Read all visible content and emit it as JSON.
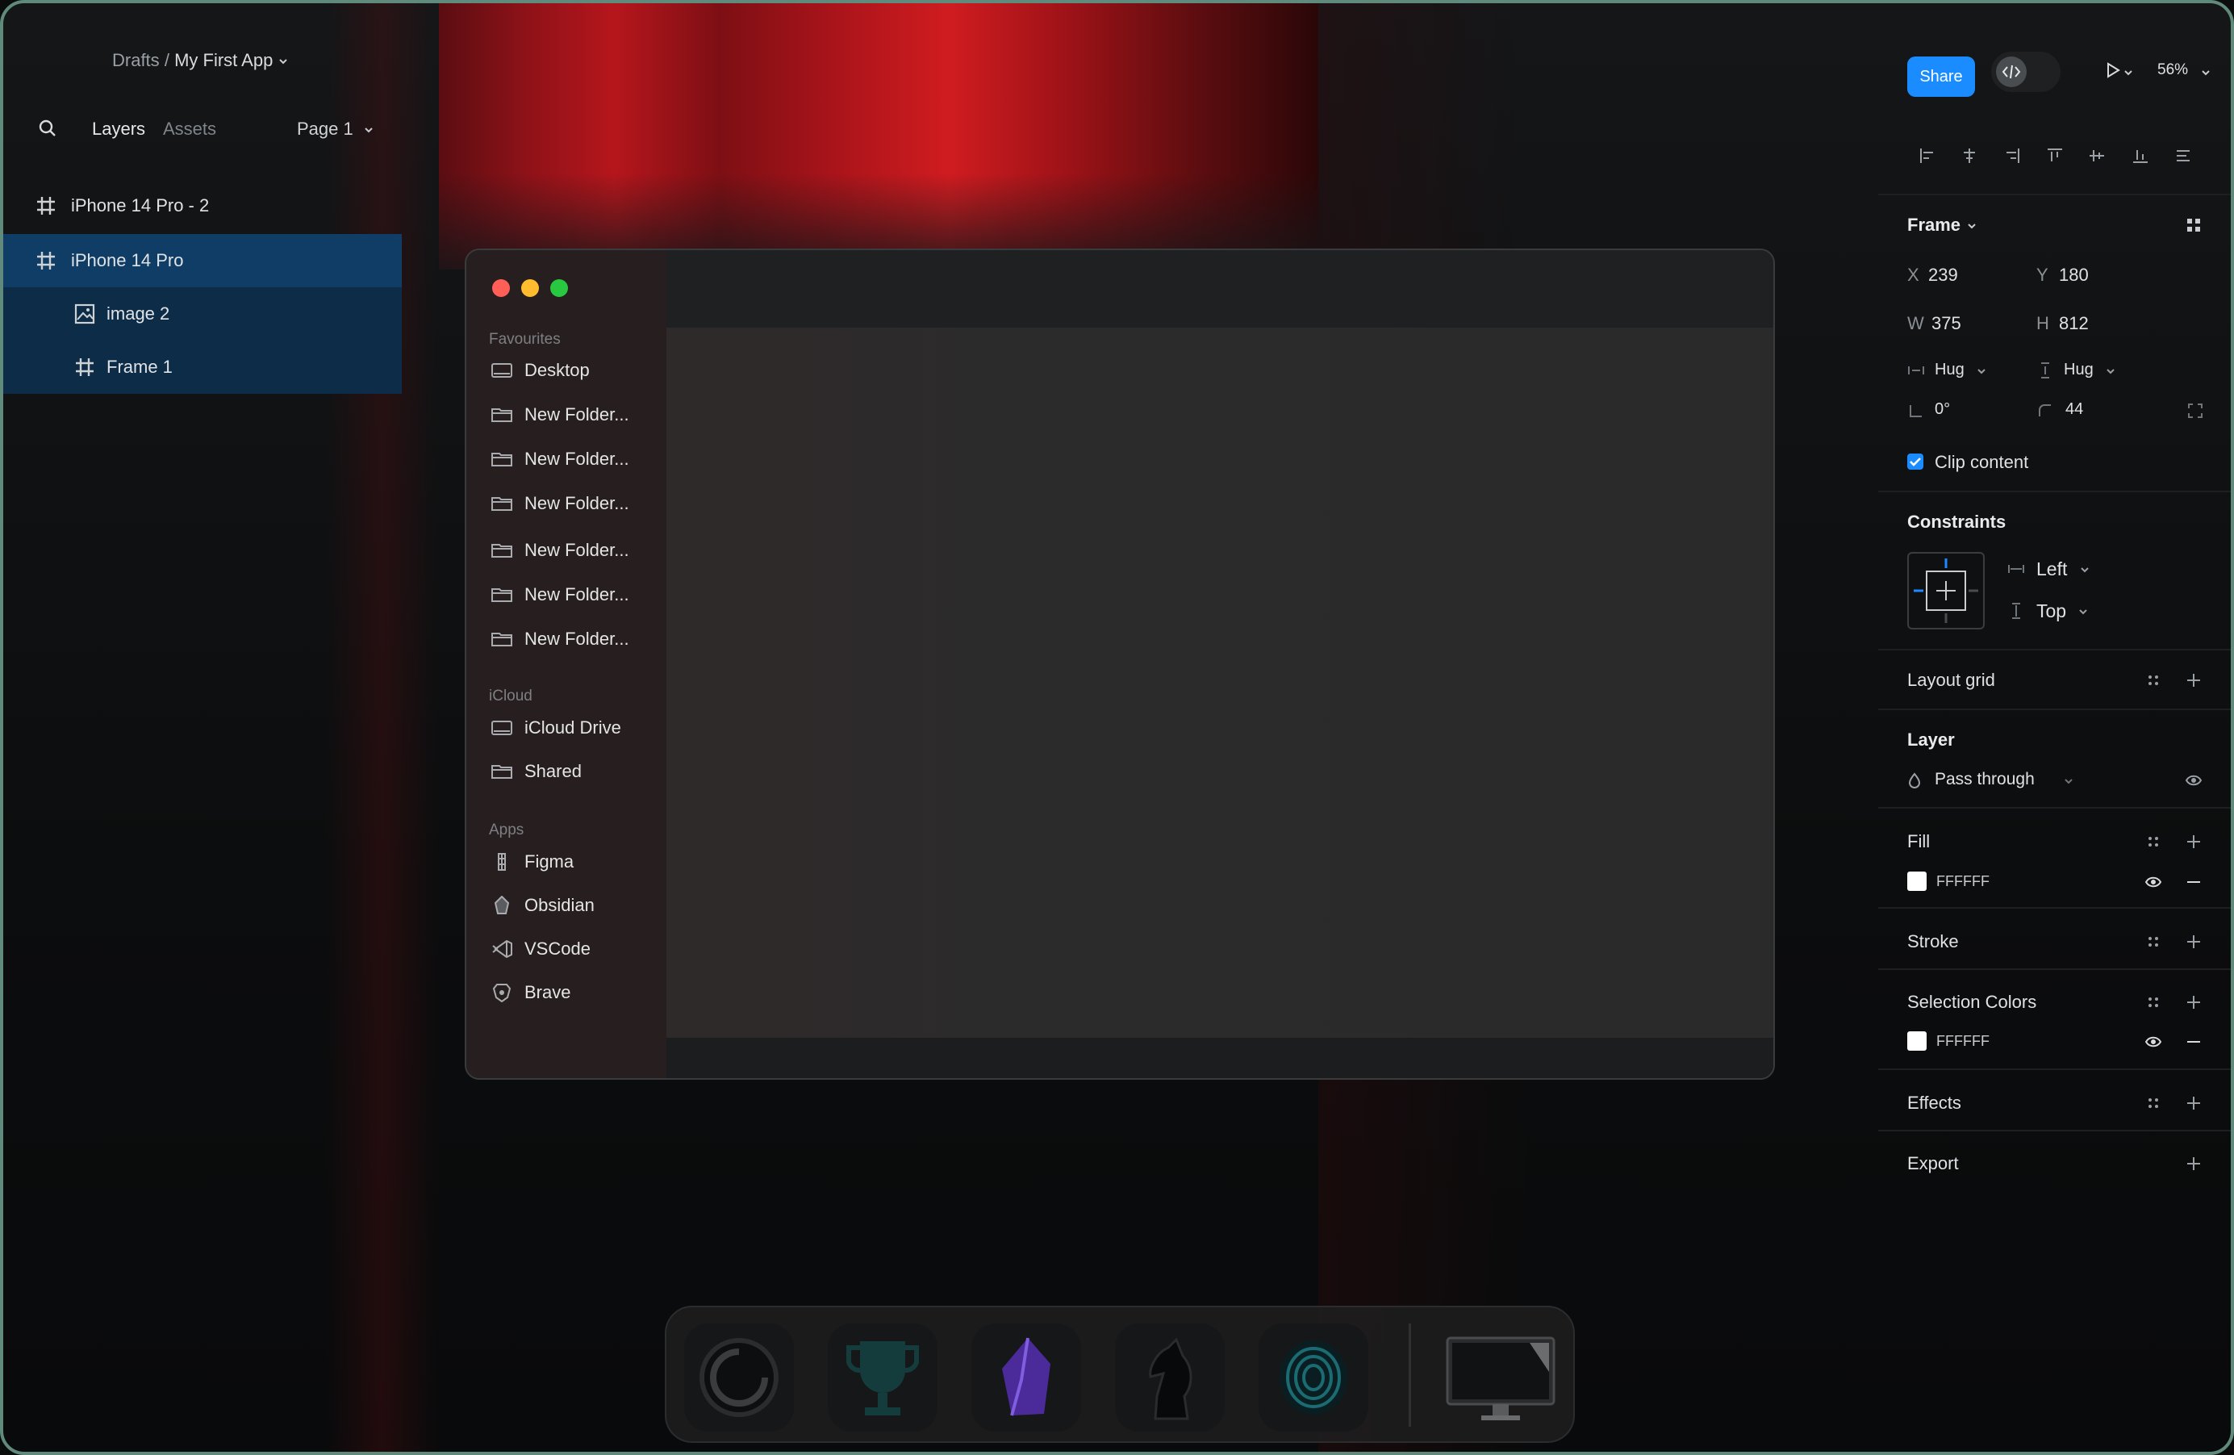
{
  "header": {
    "breadcrumb_root": "Drafts",
    "breadcrumb_sep": "/",
    "file_name": "My First App"
  },
  "left_panel": {
    "tabs": [
      "Layers",
      "Assets"
    ],
    "page": "Page 1",
    "layers": [
      {
        "label": "iPhone 14 Pro - 2",
        "icon": "frame-icon"
      },
      {
        "label": "iPhone 14 Pro",
        "icon": "frame-icon"
      },
      {
        "label": "image 2",
        "icon": "image-icon"
      },
      {
        "label": "Frame 1",
        "icon": "frame-icon"
      }
    ]
  },
  "toolbar": {
    "share_label": "Share",
    "zoom": "56%"
  },
  "finder": {
    "favourites_label": "Favourites",
    "favourites": [
      "Desktop",
      "New Folder...",
      "New Folder...",
      "New Folder...",
      "New Folder...",
      "New Folder...",
      "New Folder..."
    ],
    "icloud_label": "iCloud",
    "icloud": [
      "iCloud Drive",
      "Shared"
    ],
    "apps_label": "Apps",
    "apps": [
      "Figma",
      "Obsidian",
      "VSCode",
      "Brave"
    ]
  },
  "design_panel": {
    "frame_label": "Frame",
    "x_label": "X",
    "x": "239",
    "y_label": "Y",
    "y": "180",
    "w_label": "W",
    "w": "375",
    "h_label": "H",
    "h": "812",
    "hug_w": "Hug",
    "hug_h": "Hug",
    "rotation": "0°",
    "radius": "44",
    "clip_content": "Clip content",
    "constraints_label": "Constraints",
    "constraint_h": "Left",
    "constraint_v": "Top",
    "layout_grid_label": "Layout grid",
    "layer_label": "Layer",
    "blend_mode": "Pass through",
    "fill_label": "Fill",
    "fill_hex": "FFFFFF",
    "stroke_label": "Stroke",
    "selection_colors_label": "Selection Colors",
    "selection_hex": "FFFFFF",
    "effects_label": "Effects",
    "export_label": "Export"
  },
  "colors": {
    "accent": "#1a8cff",
    "selected_layer": "#0f3d66",
    "traffic_red": "#ff5f57",
    "traffic_yellow": "#febc2e",
    "traffic_green": "#28c840"
  }
}
